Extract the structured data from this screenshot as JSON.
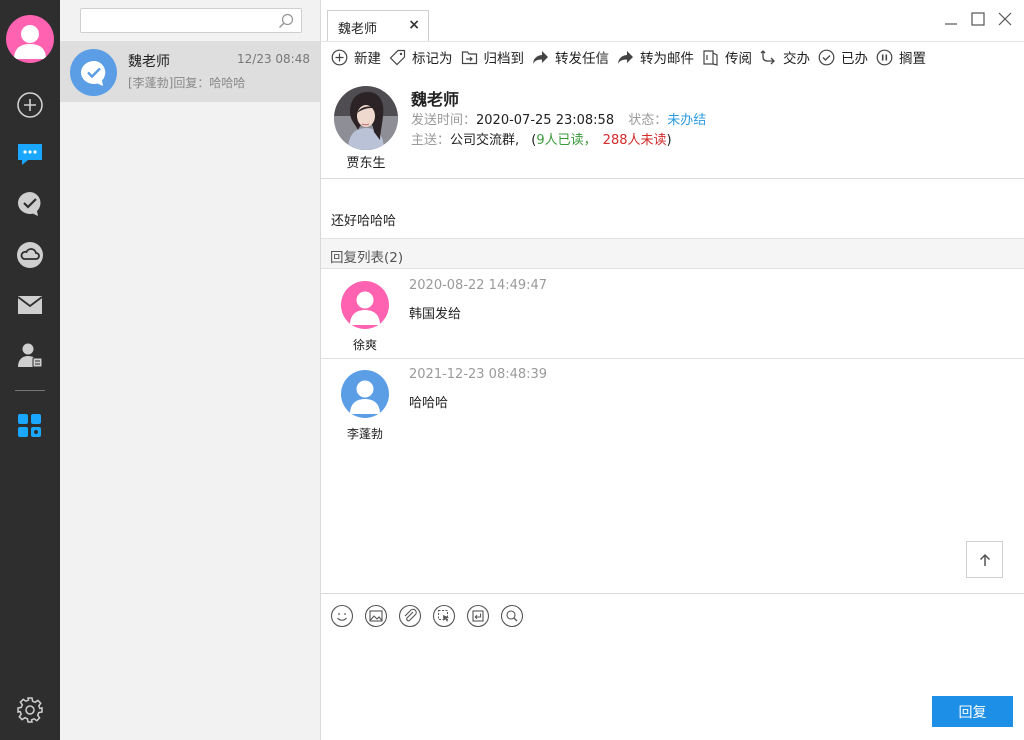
{
  "colors": {
    "rail_bg": "#2e2e2e",
    "user_avatar": "#ff62b0",
    "accent_blue": "#1e8fe6",
    "status_blue": "#2d9be0",
    "read_green": "#3a9a3a",
    "unread_red": "#d42a2a"
  },
  "rail": {
    "items": [
      "plus-circle-icon",
      "chat-icon",
      "check-bubble-icon",
      "cloud-icon",
      "mail-icon",
      "contacts-icon",
      "apps-icon"
    ],
    "settings_icon": "gear-icon"
  },
  "search": {
    "placeholder": ""
  },
  "conversation": {
    "name": "魏老师",
    "time": "12/23 08:48",
    "preview": "[李蓬勃]回复：哈哈哈"
  },
  "tab": {
    "label": "魏老师",
    "close": "×"
  },
  "toolbar": [
    {
      "label": "新建",
      "icon": "plus-circle-icon"
    },
    {
      "label": "标记为",
      "icon": "tag-icon"
    },
    {
      "label": "归档到",
      "icon": "archive-icon"
    },
    {
      "label": "转发任信",
      "icon": "forward-icon"
    },
    {
      "label": "转为邮件",
      "icon": "forward-icon"
    },
    {
      "label": "传阅",
      "icon": "circulate-icon"
    },
    {
      "label": "交办",
      "icon": "assign-icon"
    },
    {
      "label": "已办",
      "icon": "check-circle-icon"
    },
    {
      "label": "搁置",
      "icon": "pause-circle-icon"
    }
  ],
  "message": {
    "title": "魏老师",
    "sender": "贾东生",
    "sent_label": "发送时间：",
    "sent_time": "2020-07-25 23:08:58",
    "status_label": "状态：",
    "status_value": "未办结",
    "to_label": "主送：",
    "to_value": "公司交流群,",
    "open_paren": "(",
    "read_count": "9人已读",
    "comma": "，",
    "unread_count": "288人未读",
    "close_paren": ")",
    "body": "还好哈哈哈"
  },
  "replies": {
    "header": "回复列表(2)",
    "items": [
      {
        "name": "徐爽",
        "time": "2020-08-22 14:49:47",
        "text": "韩国发给",
        "avatar_color": "#ff62b0"
      },
      {
        "name": "李蓬勃",
        "time": "2021-12-23 08:48:39",
        "text": "哈哈哈",
        "avatar_color": "#5b9ee6"
      }
    ]
  },
  "composer": {
    "tools": [
      "smiley-icon",
      "image-icon",
      "attachment-icon",
      "screenshot-icon",
      "reply-box-icon",
      "search-icon"
    ],
    "send_label": "回复"
  }
}
